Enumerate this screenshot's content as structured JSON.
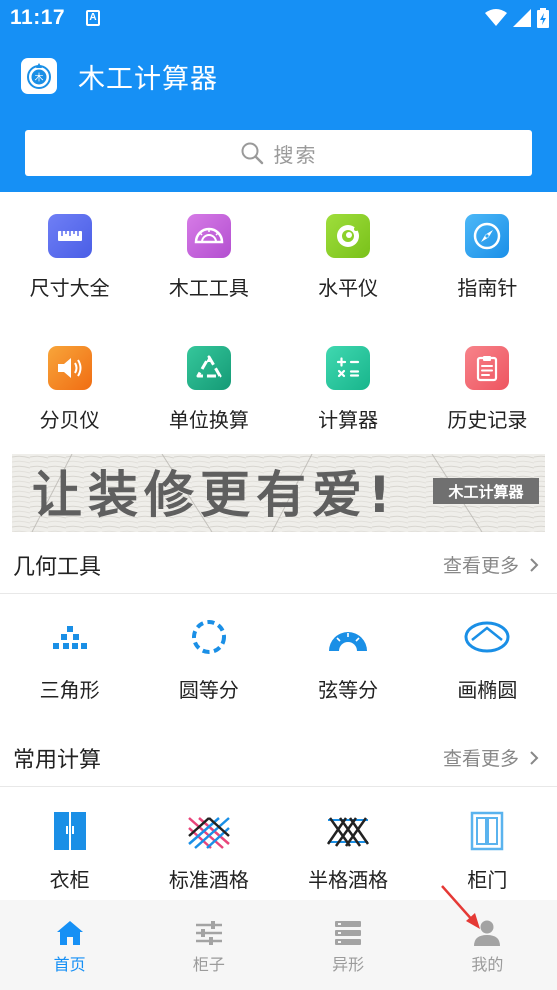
{
  "status_bar": {
    "time": "11:17",
    "notification_letter": "A"
  },
  "app": {
    "title": "木工计算器"
  },
  "search": {
    "placeholder": "搜索"
  },
  "tools_row1": [
    {
      "label": "尺寸大全",
      "icon": "ruler-icon",
      "color": "#5b6ef0"
    },
    {
      "label": "木工工具",
      "icon": "protractor-icon",
      "color": "#c864d8"
    },
    {
      "label": "水平仪",
      "icon": "level-icon",
      "color": "#8cd12a"
    },
    {
      "label": "指南针",
      "icon": "compass-icon",
      "color": "#2fa6f3"
    }
  ],
  "tools_row2": [
    {
      "label": "分贝仪",
      "icon": "speaker-icon",
      "color": "#f6881f"
    },
    {
      "label": "单位换算",
      "icon": "recycle-icon",
      "color": "#22b38a"
    },
    {
      "label": "计算器",
      "icon": "calculator-icon",
      "color": "#26c8a0"
    },
    {
      "label": "历史记录",
      "icon": "clipboard-icon",
      "color": "#f2686e"
    }
  ],
  "banner": {
    "slogan": "让装修更有爱!",
    "badge": "木工计算器"
  },
  "geometry": {
    "title": "几何工具",
    "more": "查看更多",
    "items": [
      {
        "label": "三角形",
        "icon": "triangle-icon"
      },
      {
        "label": "圆等分",
        "icon": "circle-divide-icon"
      },
      {
        "label": "弦等分",
        "icon": "chord-divide-icon"
      },
      {
        "label": "画椭圆",
        "icon": "ellipse-icon"
      }
    ]
  },
  "common": {
    "title": "常用计算",
    "more": "查看更多",
    "items": [
      {
        "label": "衣柜",
        "icon": "wardrobe-icon"
      },
      {
        "label": "标准酒格",
        "icon": "wine-rack-icon"
      },
      {
        "label": "半格酒格",
        "icon": "half-wine-rack-icon"
      },
      {
        "label": "柜门",
        "icon": "cabinet-door-icon"
      }
    ]
  },
  "tabs": [
    {
      "label": "首页",
      "icon": "home-icon",
      "active": true
    },
    {
      "label": "柜子",
      "icon": "sliders-icon",
      "active": false
    },
    {
      "label": "异形",
      "icon": "stack-icon",
      "active": false
    },
    {
      "label": "我的",
      "icon": "person-icon",
      "active": false
    }
  ],
  "colors": {
    "primary": "#1690f5",
    "icon_blue": "#1a8fe6",
    "annotation": "#e53935"
  }
}
